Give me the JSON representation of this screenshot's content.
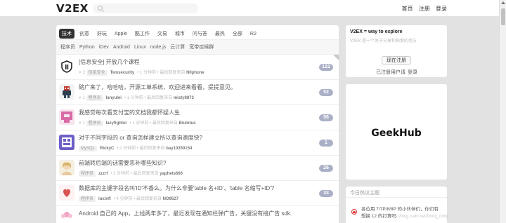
{
  "header": {
    "logo": "V2EX",
    "nav": [
      "首页",
      "注册",
      "登录"
    ]
  },
  "tabs": [
    "技术",
    "创意",
    "好玩",
    "Apple",
    "酷工作",
    "交易",
    "城市",
    "问与答",
    "最热",
    "全部",
    "R2"
  ],
  "subtabs": [
    "程序员",
    "Python",
    "iDev",
    "Android",
    "Linux",
    "node.js",
    "云计算",
    "宽带症候群"
  ],
  "topics": [
    {
      "title": "[信息安全] 开放几个课程",
      "likes": "2",
      "node": "信息安全",
      "author": "Twosecurity",
      "time": "• 1 分钟前 • 最后回复来自",
      "last": "N0phone",
      "count": "122"
    },
    {
      "title": "磅广来了，哈哈哈，开源工单系统，欢迎进来看看，提提意见。",
      "likes": "1",
      "node": "程序员",
      "author": "lanyulei",
      "time": "• 1 分钟前 • 最后回复来自",
      "last": "misty8873",
      "count": "52"
    },
    {
      "title": "我感觉每次看支付宝的文档我都怀疑人生",
      "likes": "1",
      "node": "程序员",
      "author": "lazyfighter",
      "time": "• 1 分钟前 • 最后回复来自",
      "last": "Biulntus",
      "count": "56"
    },
    {
      "title": "对于不同字段的 or 查询怎样建立所以查询速度快?",
      "likes": "",
      "node": "MySQL",
      "author": "RickyC",
      "time": "• 2 分钟前 • 最后回复来自",
      "last": "bay10350154",
      "count": "1"
    },
    {
      "title": "前端转后端的话需要恶补哪些知识?",
      "likes": "",
      "node": "程序员",
      "author": "zzzrf",
      "time": "• 2 分钟前 • 最后回复来自",
      "last": "yaphets666",
      "count": "26"
    },
    {
      "title": "数据库的主键字段名叫'ID'不香么。为什么非要'table 名+ID'、'table 名缩写+ID'?",
      "likes": "",
      "node": "程序员",
      "author": "luxinfl",
      "time": "• 4 分钟前 • 最后回复来自",
      "last": "NO9527",
      "count": "33"
    },
    {
      "title": "Android 自己的 App，上线两年多了，最近发现在通知栏弹广告，关键没有接广告 sdk.",
      "likes": "",
      "node": "",
      "author": "",
      "time": "",
      "last": "",
      "count": ""
    }
  ],
  "sidebar": {
    "title": "V2EX = way to explore",
    "subtitle": "V2EX 是一个关于分享和探索的地方",
    "register": "现在注册",
    "login_prompt": "已注册用户请",
    "login": "登录"
  },
  "ad": {
    "brand": "GeekHub"
  },
  "hot": {
    "heading": "今日热议主题",
    "text": "各位用 7/7P/8/8P 的小伙伴们，你们有想换 12 的打算吗"
  },
  "watermark": "https://blog.csdn.net/Dong_dong"
}
